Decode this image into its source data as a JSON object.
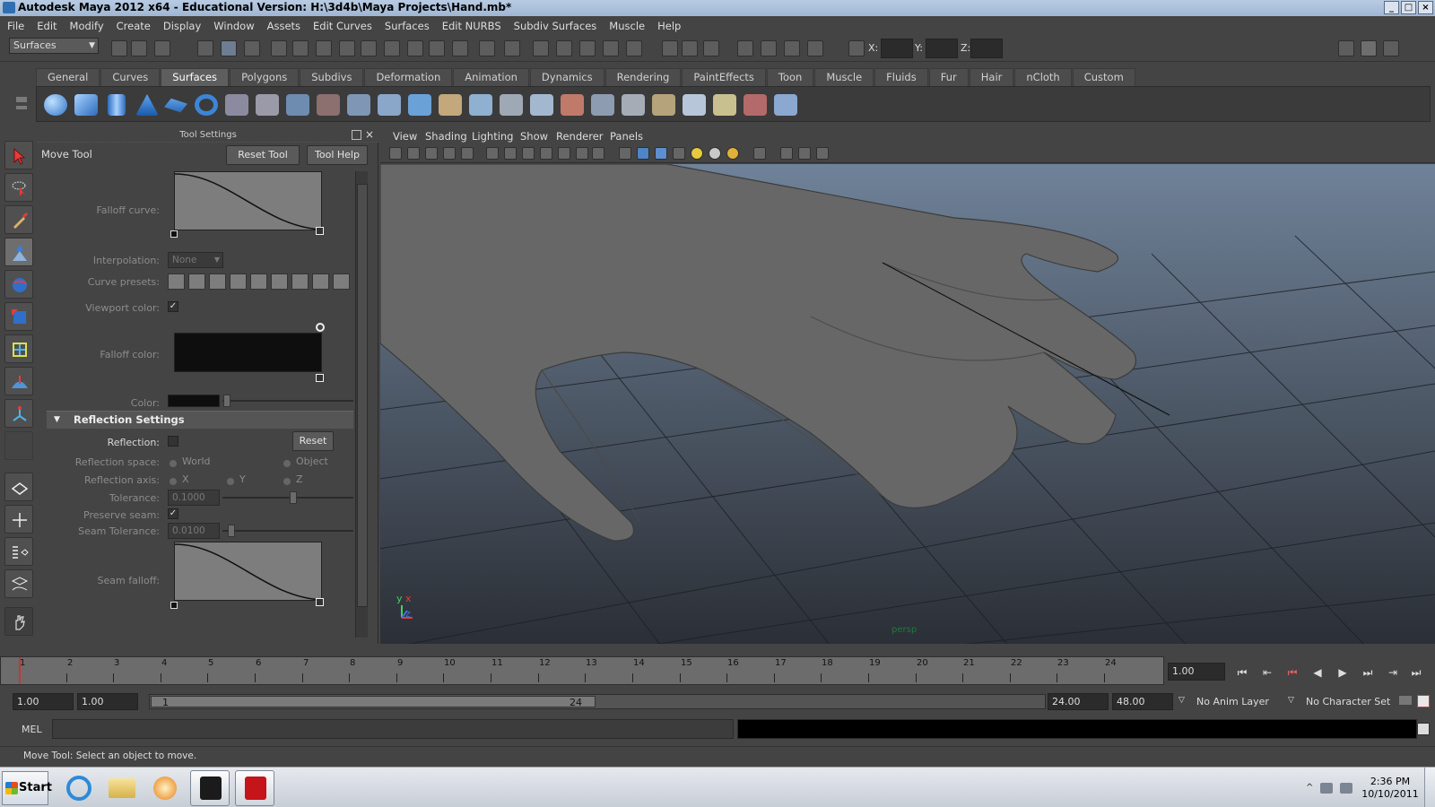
{
  "window": {
    "title": "Autodesk Maya 2012 x64 - Educational Version: H:\\3d4b\\Maya Projects\\Hand.mb*",
    "minimize": "_",
    "maximize": "□",
    "close": "×"
  },
  "menubar": [
    "File",
    "Edit",
    "Modify",
    "Create",
    "Display",
    "Window",
    "Assets",
    "Edit Curves",
    "Surfaces",
    "Edit NURBS",
    "Subdiv Surfaces",
    "Muscle",
    "Help"
  ],
  "statusline": {
    "mode": "Surfaces",
    "x_label": "X:",
    "y_label": "Y:",
    "z_label": "Z:"
  },
  "shelf_tabs": [
    "General",
    "Curves",
    "Surfaces",
    "Polygons",
    "Subdivs",
    "Deformation",
    "Animation",
    "Dynamics",
    "Rendering",
    "PaintEffects",
    "Toon",
    "Muscle",
    "Fluids",
    "Fur",
    "Hair",
    "nCloth",
    "Custom"
  ],
  "shelf_active": "Surfaces",
  "tool_settings": {
    "title": "Tool Settings",
    "tool_name": "Move Tool",
    "reset_tool": "Reset Tool",
    "tool_help": "Tool Help",
    "falloff_curve_label": "Falloff curve:",
    "interpolation_label": "Interpolation:",
    "interpolation_value": "None",
    "curve_presets_label": "Curve presets:",
    "viewport_color_label": "Viewport color:",
    "falloff_color_label": "Falloff color:",
    "color_label": "Color:",
    "reflection_section": "Reflection Settings",
    "reflection_label": "Reflection:",
    "reset": "Reset",
    "reflection_space_label": "Reflection space:",
    "world": "World",
    "object": "Object",
    "reflection_axis_label": "Reflection axis:",
    "axis_x": "X",
    "axis_y": "Y",
    "axis_z": "Z",
    "tolerance_label": "Tolerance:",
    "tolerance_value": "0.1000",
    "preserve_seam_label": "Preserve seam:",
    "seam_tolerance_label": "Seam Tolerance:",
    "seam_tolerance_value": "0.0100",
    "seam_falloff_label": "Seam falloff:",
    "checkmark": "✓"
  },
  "viewport": {
    "menus": [
      "View",
      "Shading",
      "Lighting",
      "Show",
      "Renderer",
      "Panels"
    ],
    "camera_label": "persp",
    "axis_y": "y",
    "axis_x": "x",
    "axis_z": "z"
  },
  "timeline": {
    "ticks": [
      "1",
      "2",
      "3",
      "4",
      "5",
      "6",
      "7",
      "8",
      "9",
      "10",
      "11",
      "12",
      "13",
      "14",
      "15",
      "16",
      "17",
      "18",
      "19",
      "20",
      "21",
      "22",
      "23",
      "24"
    ],
    "current_frame": "1.00"
  },
  "range": {
    "start": "1.00",
    "anim_start": "1.00",
    "slider_start": "1",
    "slider_end": "24",
    "end": "24.00",
    "anim_end": "48.00",
    "anim_layer": "No Anim Layer",
    "character_set": "No Character Set"
  },
  "command": {
    "label": "MEL"
  },
  "helpline": "Move Tool: Select an object to move.",
  "taskbar": {
    "start": "Start",
    "time": "2:36 PM",
    "date": "10/10/2011"
  },
  "colors": {
    "background": "#444444",
    "viewport_top": "#6f8299",
    "viewport_bottom": "#2b2f36",
    "grid": "#1e2228",
    "hand": "#6a6a6a"
  }
}
